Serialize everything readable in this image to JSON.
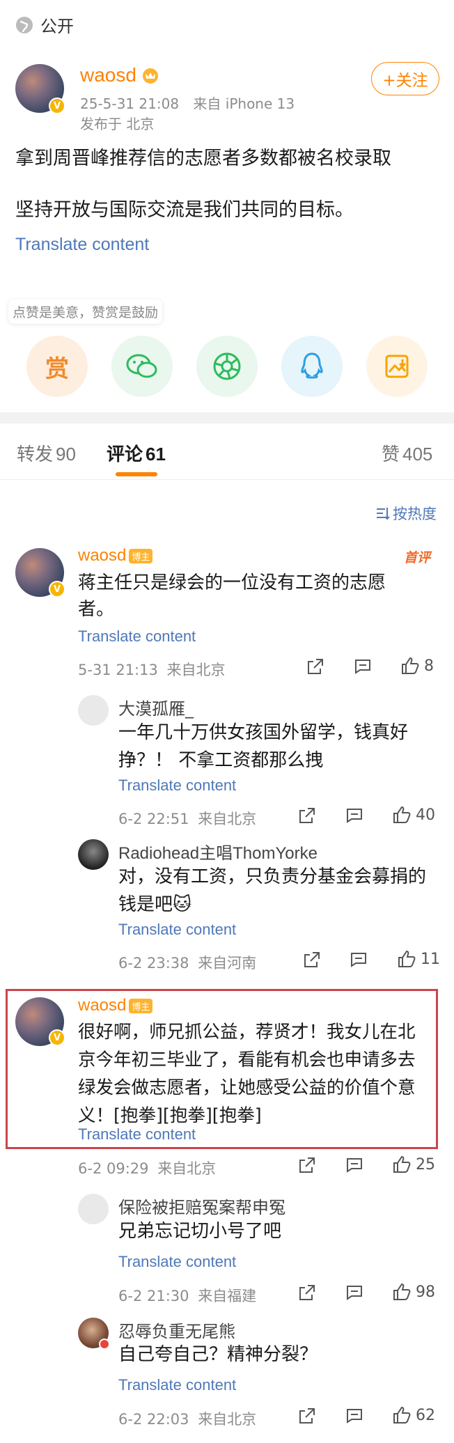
{
  "visibility": {
    "label": "公开"
  },
  "post": {
    "author": "waosd",
    "follow_label": "+关注",
    "time": "25-5-31 21:08",
    "source": "来自 iPhone 13",
    "location": "发布于 北京",
    "line1": "拿到周晋峰推荐信的志愿者多数都被名校录取",
    "line2": "坚持开放与国际交流是我们共同的目标。",
    "translate": "Translate content"
  },
  "tip": {
    "text": "点赞是美意，赞赏是鼓励",
    "reward_label": "赏"
  },
  "tabs": {
    "repost": "转发",
    "repost_count": "90",
    "comment": "评论",
    "comment_count": "61",
    "like": "赞",
    "like_count": "405"
  },
  "sort": {
    "label": "按热度"
  },
  "comments": [
    {
      "name": "waosd",
      "tag": "博主",
      "badge": "首评",
      "text": "蒋主任只是绿会的一位没有工资的志愿者。",
      "translate": "Translate content",
      "time": "5-31 21:13",
      "source": "来自北京",
      "likes": "8",
      "replies": [
        {
          "name": "大漠孤雁_",
          "text": "一年几十万供女孩国外留学，钱真好挣？！ 不拿工资都那么拽",
          "translate": "Translate content",
          "time": "6-2 22:51",
          "source": "来自北京",
          "likes": "40"
        },
        {
          "name": "Radiohead主唱ThomYorke",
          "text": "对，没有工资，只负责分基金会募捐的钱是吧🐱",
          "translate": "Translate content",
          "time": "6-2 23:38",
          "source": "来自河南",
          "likes": "11"
        }
      ]
    },
    {
      "name": "waosd",
      "tag": "博主",
      "text": "很好啊，师兄抓公益，荐贤才！我女儿在北京今年初三毕业了，看能有机会也申请多去绿发会做志愿者，让她感受公益的价值个意义！[抱拳][抱拳][抱拳]",
      "translate": "Translate content",
      "time": "6-2 09:29",
      "source": "来自北京",
      "likes": "25",
      "replies": [
        {
          "name": "保险被拒赔冤案帮申冤",
          "text": "兄弟忘记切小号了吧",
          "translate": "Translate content",
          "time": "6-2 21:30",
          "source": "来自福建",
          "likes": "98"
        },
        {
          "name": "忍辱负重无尾熊",
          "text": "自己夸自己？精神分裂？",
          "translate": "Translate content",
          "time": "6-2 22:03",
          "source": "来自北京",
          "likes": "62"
        }
      ]
    }
  ],
  "colors": {
    "accent": "#ff8200",
    "link": "#4f78b8",
    "highlight_border": "#c9464c"
  }
}
